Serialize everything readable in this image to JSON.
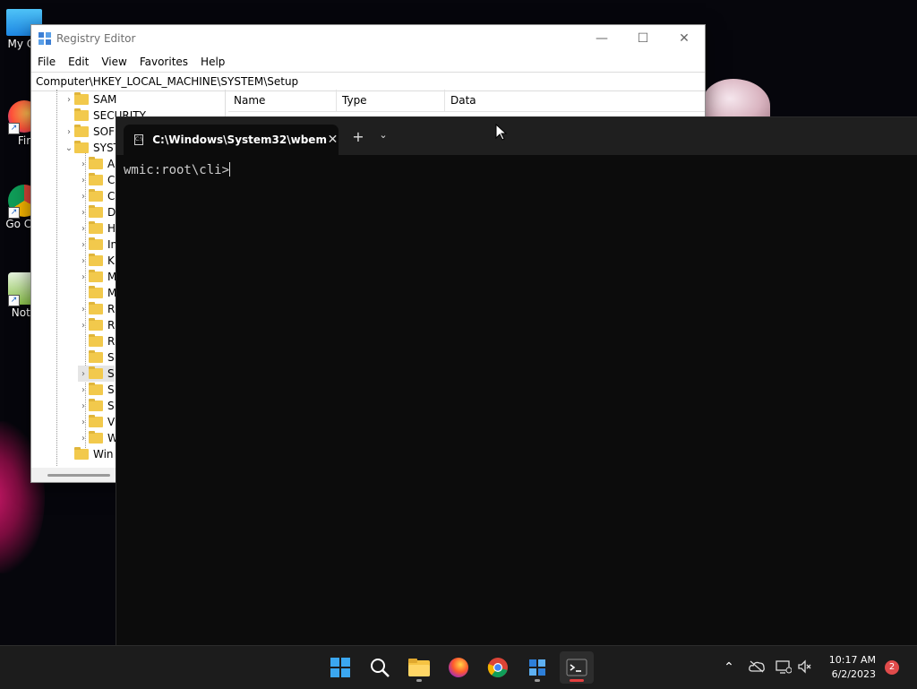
{
  "desktop": {
    "icons": [
      {
        "label": "My Co",
        "kind": "computer"
      },
      {
        "label": "Fir",
        "kind": "firefox"
      },
      {
        "label": "Go Chr",
        "kind": "chrome"
      },
      {
        "label": "Note",
        "kind": "notepad"
      }
    ]
  },
  "regedit": {
    "title": "Registry Editor",
    "menu": [
      "File",
      "Edit",
      "View",
      "Favorites",
      "Help"
    ],
    "address": "Computer\\HKEY_LOCAL_MACHINE\\SYSTEM\\Setup",
    "columns": [
      "Name",
      "Type",
      "Data"
    ],
    "tree": [
      {
        "label": "SAM",
        "expander": ">"
      },
      {
        "label": "SECURITY",
        "expander": ""
      },
      {
        "label": "SOF",
        "expander": ">"
      },
      {
        "label": "SYST",
        "expander": "v"
      },
      {
        "label": "A",
        "expander": ">"
      },
      {
        "label": "C",
        "expander": ">"
      },
      {
        "label": "C",
        "expander": ">"
      },
      {
        "label": "D",
        "expander": ">"
      },
      {
        "label": "H",
        "expander": ">"
      },
      {
        "label": "In",
        "expander": ">"
      },
      {
        "label": "K",
        "expander": ">"
      },
      {
        "label": "M",
        "expander": ">"
      },
      {
        "label": "M",
        "expander": ""
      },
      {
        "label": "R",
        "expander": ">"
      },
      {
        "label": "R",
        "expander": ">"
      },
      {
        "label": "R",
        "expander": ""
      },
      {
        "label": "S",
        "expander": ""
      },
      {
        "label": "S",
        "expander": ">"
      },
      {
        "label": "S",
        "expander": ">"
      },
      {
        "label": "S",
        "expander": ">"
      },
      {
        "label": "V",
        "expander": ">"
      },
      {
        "label": "W",
        "expander": ">"
      },
      {
        "label": "Win",
        "expander": ""
      }
    ]
  },
  "terminal": {
    "tab_title": "C:\\Windows\\System32\\wbem",
    "new_tab": "+",
    "dropdown": "⌄",
    "prompt": "wmic:root\\cli>"
  },
  "taskbar": {
    "apps": [
      "start",
      "search",
      "file-explorer",
      "firefox",
      "chrome",
      "regedit",
      "terminal"
    ],
    "time": "10:17 AM",
    "date": "6/2/2023",
    "notifications": "2"
  },
  "colors": {
    "terminal_bg": "#0c0c0c",
    "taskbar_bg": "#1c1c1c",
    "accent": "#0078d4"
  }
}
